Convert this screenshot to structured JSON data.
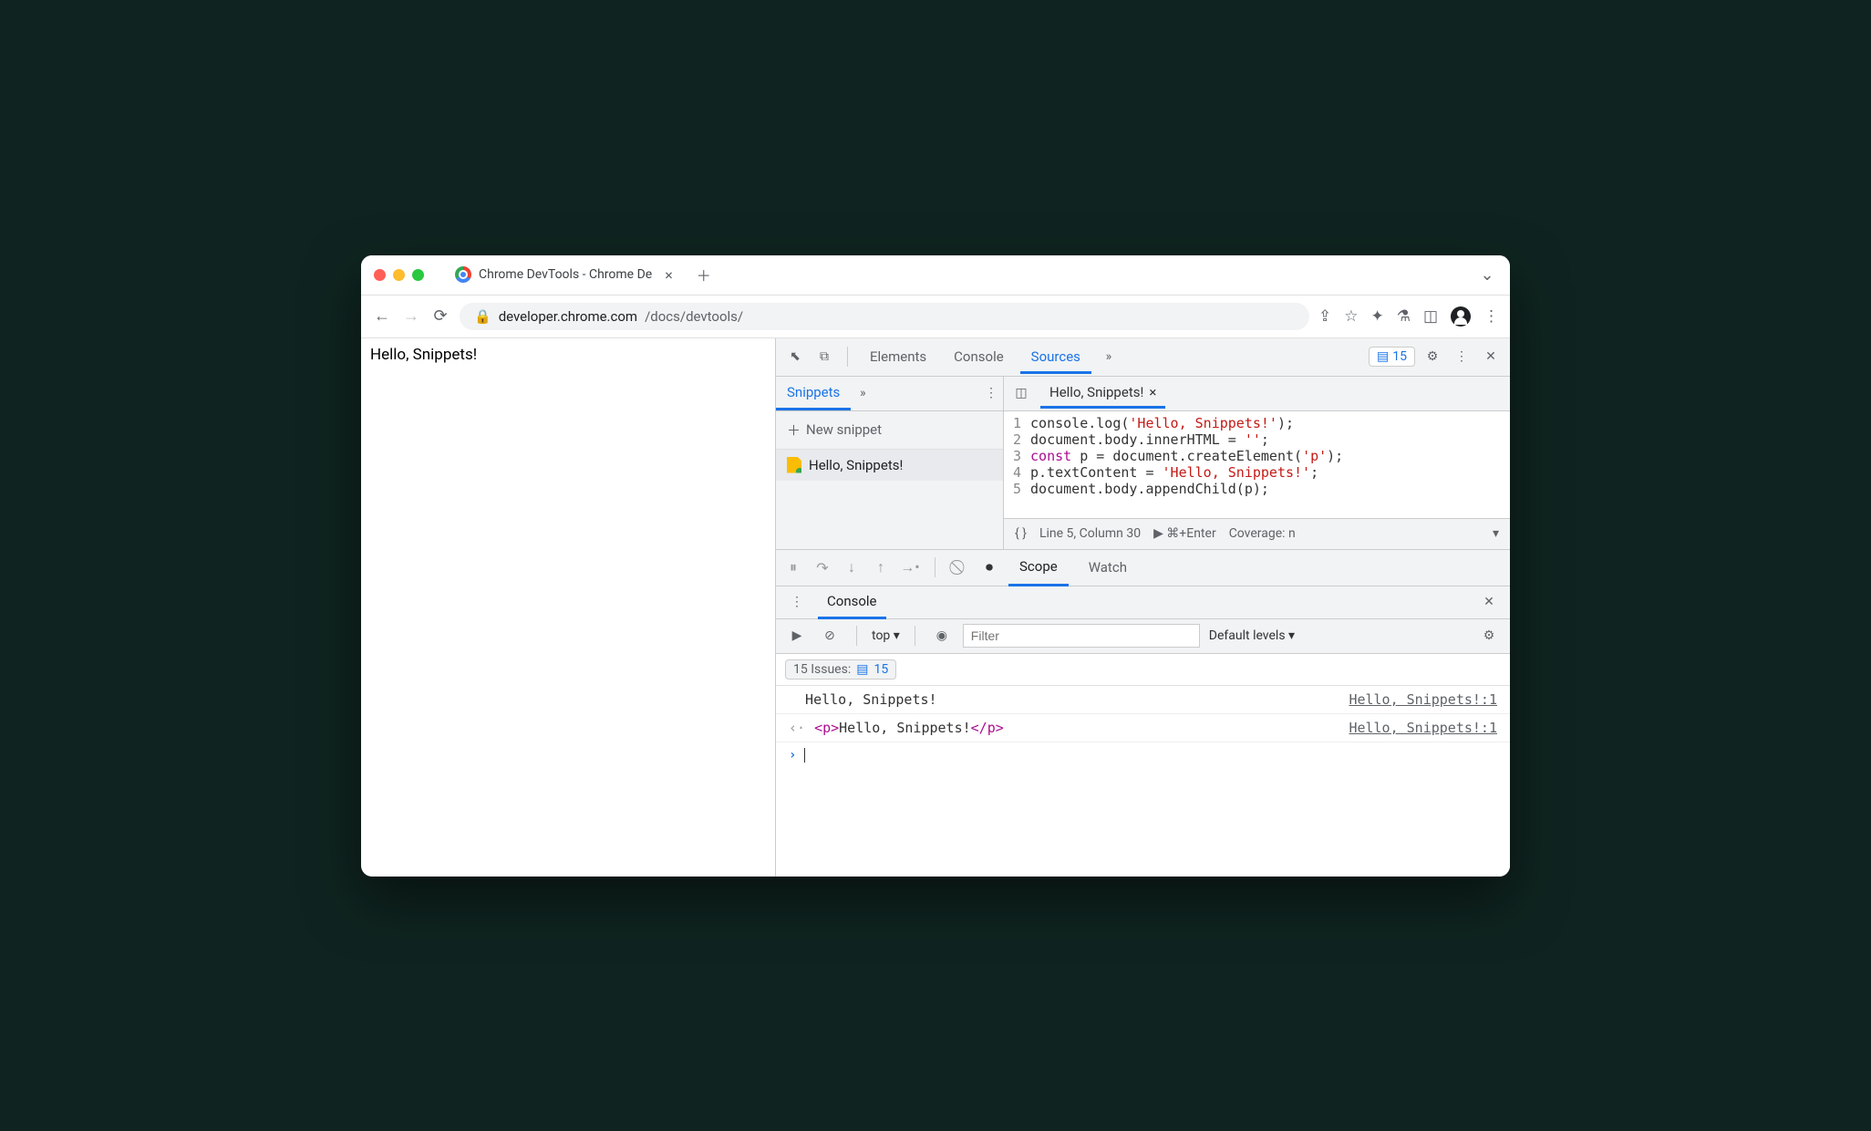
{
  "browser": {
    "tab_title": "Chrome DevTools - Chrome De",
    "url_domain": "developer.chrome.com",
    "url_path": "/docs/devtools/"
  },
  "page": {
    "body_text": "Hello, Snippets!"
  },
  "devtools": {
    "toolbar": {
      "tabs": [
        "Elements",
        "Console",
        "Sources"
      ],
      "active_tab": "Sources",
      "overflow_icon": "»",
      "issues_count": "15"
    },
    "snippets": {
      "tab_label": "Snippets",
      "new_label": "New snippet",
      "items": [
        "Hello, Snippets!"
      ]
    },
    "editor": {
      "tab_name": "Hello, Snippets!",
      "lines": [
        {
          "n": "1",
          "raw": "console.log('Hello, Snippets!');",
          "html": "console.log(<span class='tok-str'>'Hello, Snippets!'</span>);"
        },
        {
          "n": "2",
          "raw": "document.body.innerHTML = '';",
          "html": "document.body.innerHTML = <span class='tok-str'>''</span>;"
        },
        {
          "n": "3",
          "raw": "const p = document.createElement('p');",
          "html": "<span class='tok-kw'>const</span> p = document.createElement(<span class='tok-str'>'p'</span>);"
        },
        {
          "n": "4",
          "raw": "p.textContent = 'Hello, Snippets!';",
          "html": "p.textContent = <span class='tok-str'>'Hello, Snippets!'</span>;"
        },
        {
          "n": "5",
          "raw": "document.body.appendChild(p);",
          "html": "document.body.appendChild(p);"
        }
      ],
      "status_line": "Line 5, Column 30",
      "status_run": "▶ ⌘+Enter",
      "status_coverage": "Coverage: n"
    },
    "debug": {
      "tabs": [
        "Scope",
        "Watch"
      ],
      "active": "Scope"
    },
    "console": {
      "tab_label": "Console",
      "context": "top",
      "filter_placeholder": "Filter",
      "levels": "Default levels",
      "issues_label": "15 Issues:",
      "issues_badge": "15",
      "rows": [
        {
          "text": "Hello, Snippets!",
          "link": "Hello, Snippets!:1",
          "type": "log"
        },
        {
          "text": "<p>Hello, Snippets!</p>",
          "link": "Hello, Snippets!:1",
          "type": "return"
        }
      ]
    }
  }
}
